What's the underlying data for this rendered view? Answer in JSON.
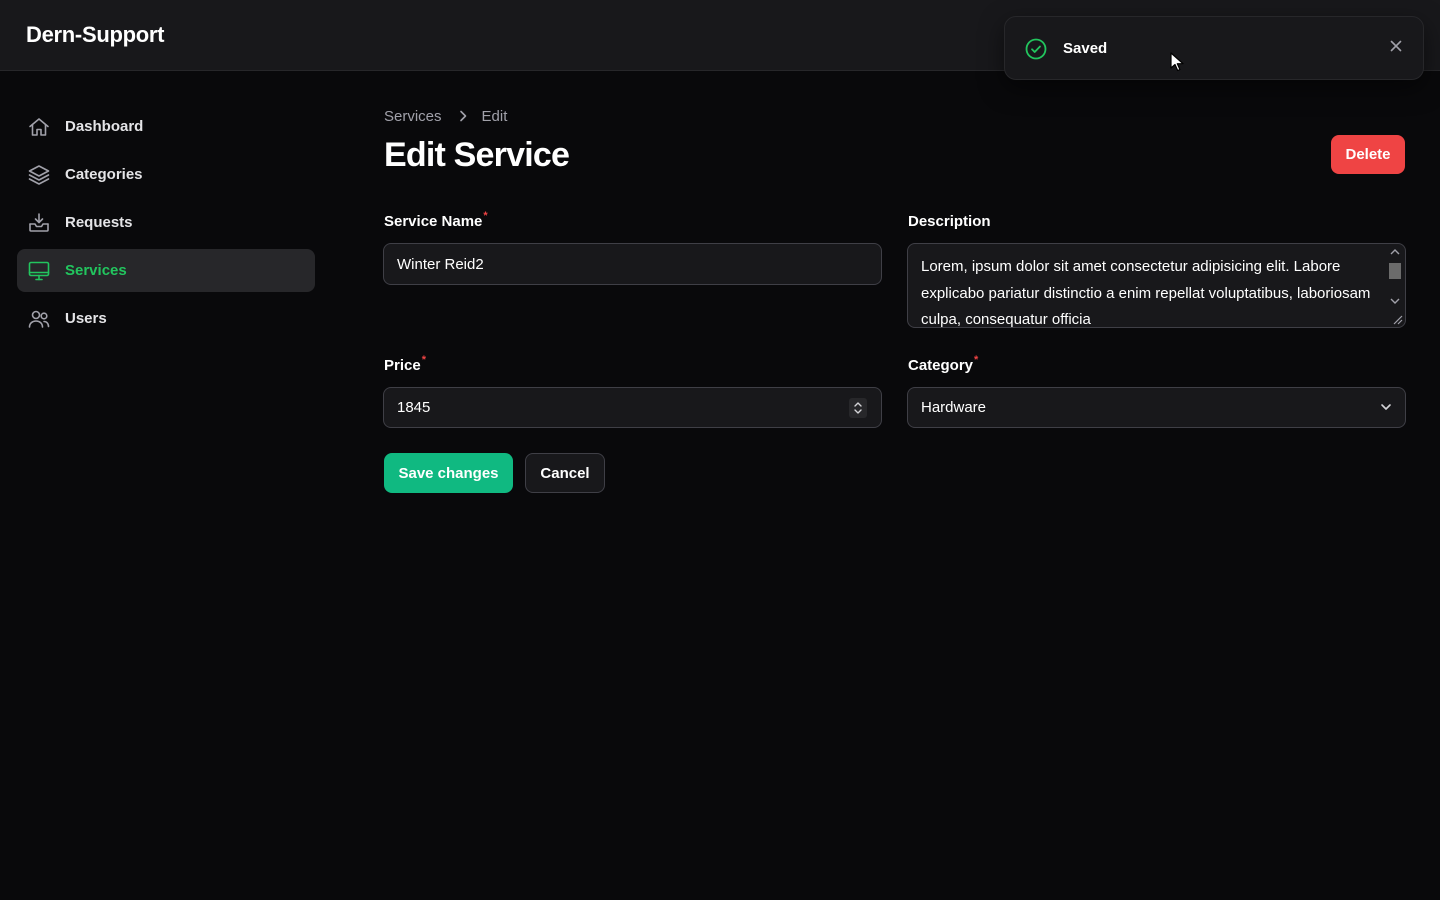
{
  "app": {
    "brand": "Dern-Support"
  },
  "sidebar": {
    "items": [
      {
        "label": "Dashboard",
        "icon": "home-icon",
        "active": false
      },
      {
        "label": "Categories",
        "icon": "layers-icon",
        "active": false
      },
      {
        "label": "Requests",
        "icon": "inbox-icon",
        "active": false
      },
      {
        "label": "Services",
        "icon": "monitor-icon",
        "active": true
      },
      {
        "label": "Users",
        "icon": "users-icon",
        "active": false
      }
    ]
  },
  "breadcrumb": {
    "items": [
      "Services",
      "Edit"
    ]
  },
  "page": {
    "title": "Edit Service",
    "delete_label": "Delete"
  },
  "form": {
    "service_name": {
      "label": "Service Name",
      "required_mark": "*",
      "value": "Winter Reid2"
    },
    "description": {
      "label": "Description",
      "value": "Lorem, ipsum dolor sit amet consectetur adipisicing elit. Labore explicabo pariatur distinctio a enim repellat voluptatibus, laboriosam culpa, consequatur officia"
    },
    "price": {
      "label": "Price",
      "required_mark": "*",
      "value": "1845"
    },
    "category": {
      "label": "Category",
      "required_mark": "*",
      "value": "Hardware"
    },
    "save_label": "Save changes",
    "cancel_label": "Cancel"
  },
  "toast": {
    "message": "Saved"
  },
  "colors": {
    "accent": "#22c55e",
    "primary_button": "#10b981",
    "danger": "#ef4444",
    "background": "#09090b",
    "surface": "#18181b"
  }
}
